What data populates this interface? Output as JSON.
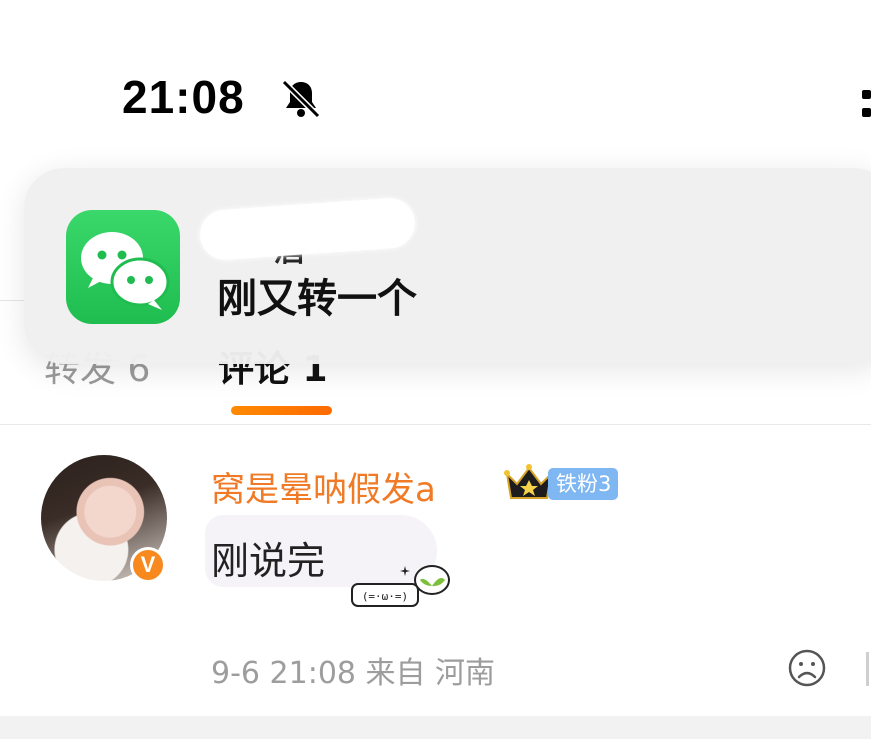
{
  "status_bar": {
    "time": "21:08",
    "icons": [
      "bell-muted-icon",
      "signal-icon"
    ]
  },
  "notification": {
    "app_icon": "wechat-icon",
    "sender_visible_fragment": "酒",
    "message": "刚又转一个"
  },
  "tabs": {
    "repost_label": "转发 6",
    "comment_label": "评论 1"
  },
  "comment": {
    "username": "窝是晕呐假发a",
    "badge_icon": "crown-icon",
    "fan_badge": "铁粉3",
    "text": "刚说完",
    "sticker_text": "(=·ω·=)",
    "meta": "9-6 21:08 来自 河南",
    "verified_mark": "V"
  },
  "colors": {
    "accent_orange": "#f07a25",
    "wechat_green": "#1fbd4f",
    "fan_badge_blue": "#7fb7f2",
    "muted_gray": "#9d9d9d"
  }
}
